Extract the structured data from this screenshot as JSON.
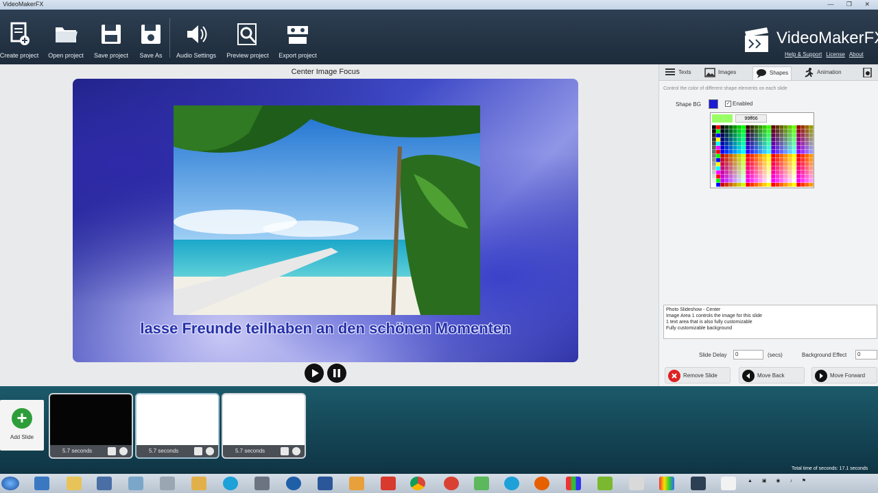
{
  "window": {
    "title": "VideoMakerFX",
    "controls": "— ❐ ✕"
  },
  "toolbar": {
    "create_project": "Create project",
    "open_project": "Open project",
    "save_project": "Save project",
    "save_as": "Save As",
    "audio_settings": "Audio Settings",
    "preview_project": "Preview project",
    "export_project": "Export project"
  },
  "brand": {
    "name": "VideoMakerFX",
    "help": "Help & Support",
    "license": "License",
    "about": "About"
  },
  "preview": {
    "title": "Center Image Focus",
    "caption": "lasse Freunde teilhaben an den schönen Momenten"
  },
  "panel": {
    "tabs": [
      "Texts",
      "Images",
      "Shapes",
      "Animation"
    ],
    "active_tab": "Shapes",
    "hint": "Control the color of different shape elements on each slide",
    "shape_bg_label": "Shape BG",
    "enabled_label": "Enabled",
    "enabled_checked": true,
    "picker_hex": "99ff66",
    "shape_color": "#1a1ad4",
    "description": [
      "Photo Slideshow - Center",
      "Image Area 1 controls the image for this slide",
      "1 text area that is also fully customizable",
      "Fully customizable background"
    ],
    "slide_delay_label": "Slide Delay",
    "slide_delay_value": "0",
    "secs_label": "(secs)",
    "bg_effect_label": "Background Effect",
    "bg_effect_value": "0",
    "remove_slide": "Remove Slide",
    "move_back": "Move Back",
    "move_forward": "Move Forward"
  },
  "timeline": {
    "add_slide": "Add Slide",
    "slides": [
      {
        "duration": "5.7 seconds"
      },
      {
        "duration": "5.7 seconds"
      },
      {
        "duration": "5.7 seconds"
      }
    ],
    "total_time": "Total time of seconds: 17.1 seconds"
  }
}
